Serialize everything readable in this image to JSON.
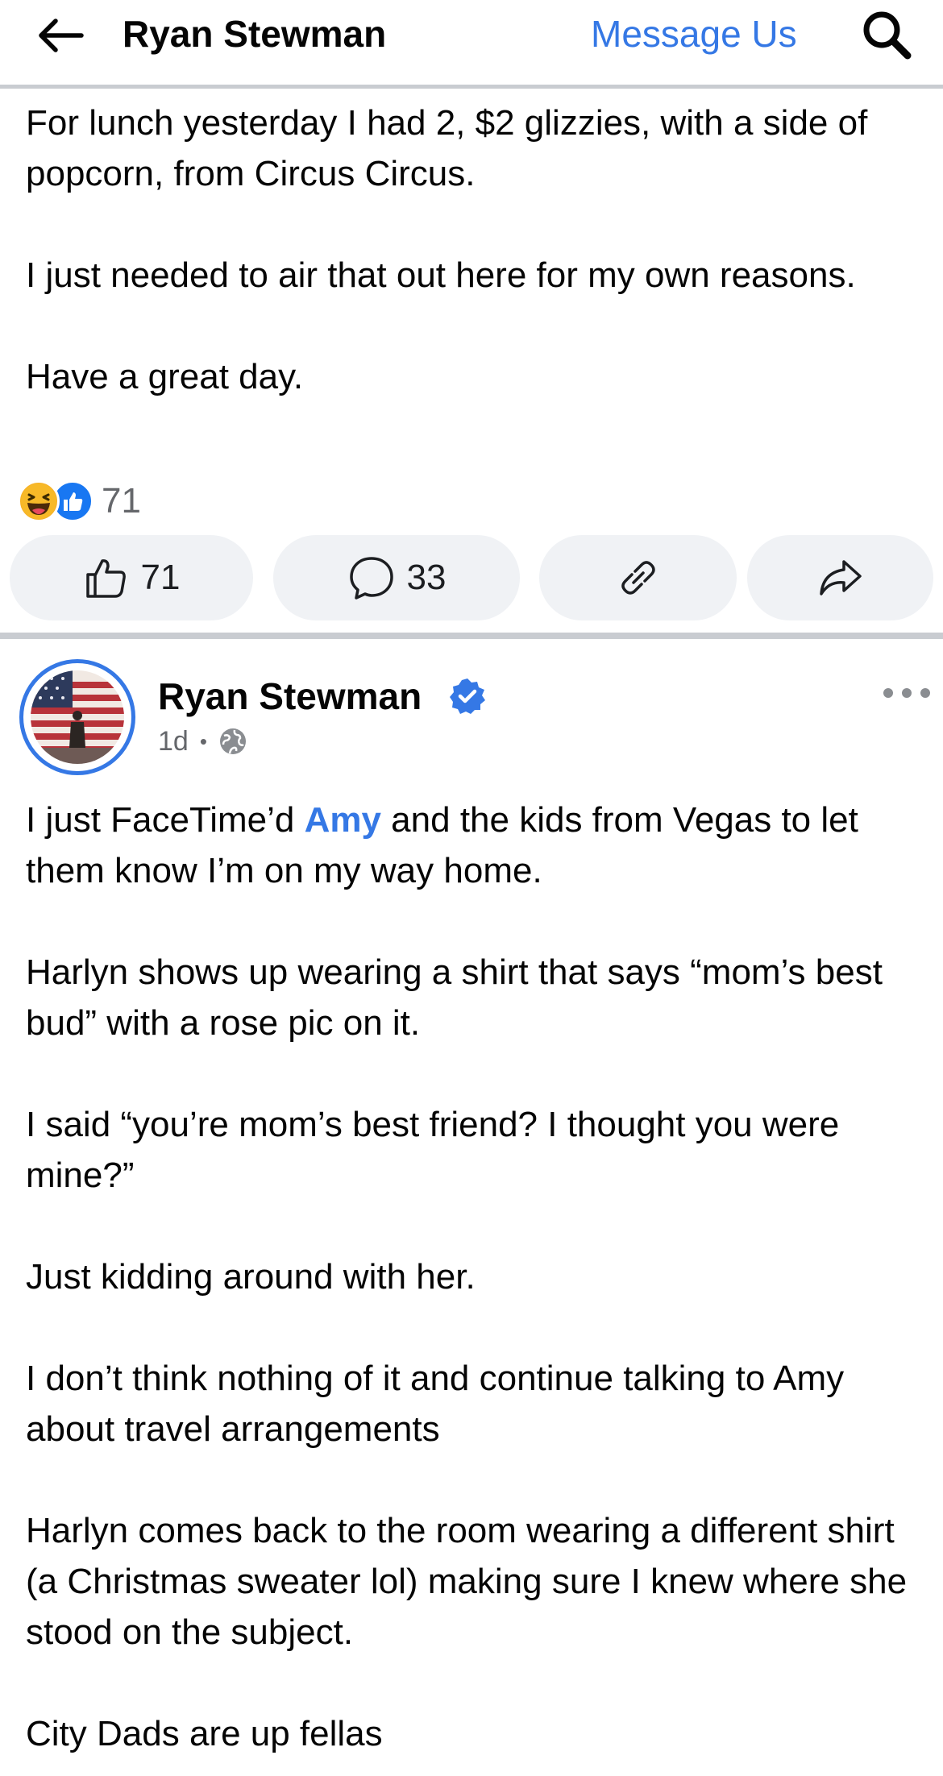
{
  "header": {
    "title": "Ryan Stewman",
    "message_us": "Message Us"
  },
  "post1": {
    "paragraphs": [
      "For lunch yesterday I had 2, $2 glizzies, with a side of popcorn, from Circus Circus.",
      "I just needed to air that out here for my own reasons.",
      "Have a great day."
    ],
    "reaction_count": "71",
    "reaction_icons": [
      "haha-emoji-icon",
      "like-reaction-icon"
    ],
    "actions": {
      "like_count": "71",
      "comment_count": "33"
    }
  },
  "post2": {
    "author": "Ryan Stewman",
    "time": "1d",
    "privacy_icon": "globe-icon",
    "p1_before": "I just FaceTime’d ",
    "p1_mention": "Amy",
    "p1_after": " and the kids from Vegas to let them know I’m on my way home.",
    "paragraphs": [
      "Harlyn shows up wearing a shirt that says “mom’s best bud” with a rose pic on it.",
      "I said “you’re mom’s best friend? I thought you were mine?”",
      "Just kidding around with her.",
      "I don’t think nothing of it and continue talking to Amy about travel arrangements",
      "Harlyn comes back to the room wearing a different shirt (a Christmas sweater lol) making sure I knew where she stood on the subject.",
      "City Dads are up fellas"
    ]
  },
  "colors": {
    "accent": "#3578e5",
    "pill_bg": "#f0f2f5",
    "divider": "#c9ccd1",
    "secondary_text": "#65676b"
  }
}
